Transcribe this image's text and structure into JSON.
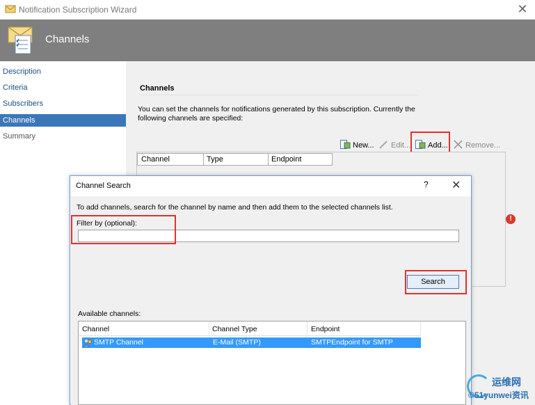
{
  "window": {
    "title": "Notification Subscription Wizard",
    "close_glyph": "✕"
  },
  "banner": {
    "heading": "Channels"
  },
  "nav": {
    "items": [
      {
        "label": "Description"
      },
      {
        "label": "Criteria"
      },
      {
        "label": "Subscribers"
      },
      {
        "label": "Channels",
        "selected": true
      },
      {
        "label": "Summary"
      }
    ]
  },
  "content": {
    "section_title": "Channels",
    "intro_line1": "You can set the channels for notifications generated by this subscription.  Currently the",
    "intro_line2": "following channels are specified:",
    "toolbar": {
      "new": "New...",
      "edit": "Edit...",
      "add": "Add...",
      "remove": "Remove..."
    },
    "grid_columns": [
      "Channel",
      "Type",
      "Endpoint"
    ],
    "error_glyph": "!"
  },
  "dialog": {
    "title": "Channel Search",
    "help": "?",
    "close": "✕",
    "hint": "To add channels, search for the channel by name and then add them to the selected channels list.",
    "filter_label": "Filter by (optional):",
    "filter_value": "",
    "search_button": "Search",
    "available_label": "Available channels:",
    "columns": [
      "Channel",
      "Channel Type",
      "Endpoint"
    ],
    "rows": [
      {
        "channel": "SMTP Channel",
        "type": "E-Mail (SMTP)",
        "endpoint": "SMTPEndpoint for SMTP Channel"
      }
    ]
  },
  "watermark": {
    "cn": "运维网",
    "en": "©51yunwei",
    "cn2": "资讯"
  },
  "colors": {
    "banner": "#7f7f7f",
    "selection": "#3b77b6",
    "highlight": "#e0312f",
    "row_selected": "#3399ff"
  }
}
